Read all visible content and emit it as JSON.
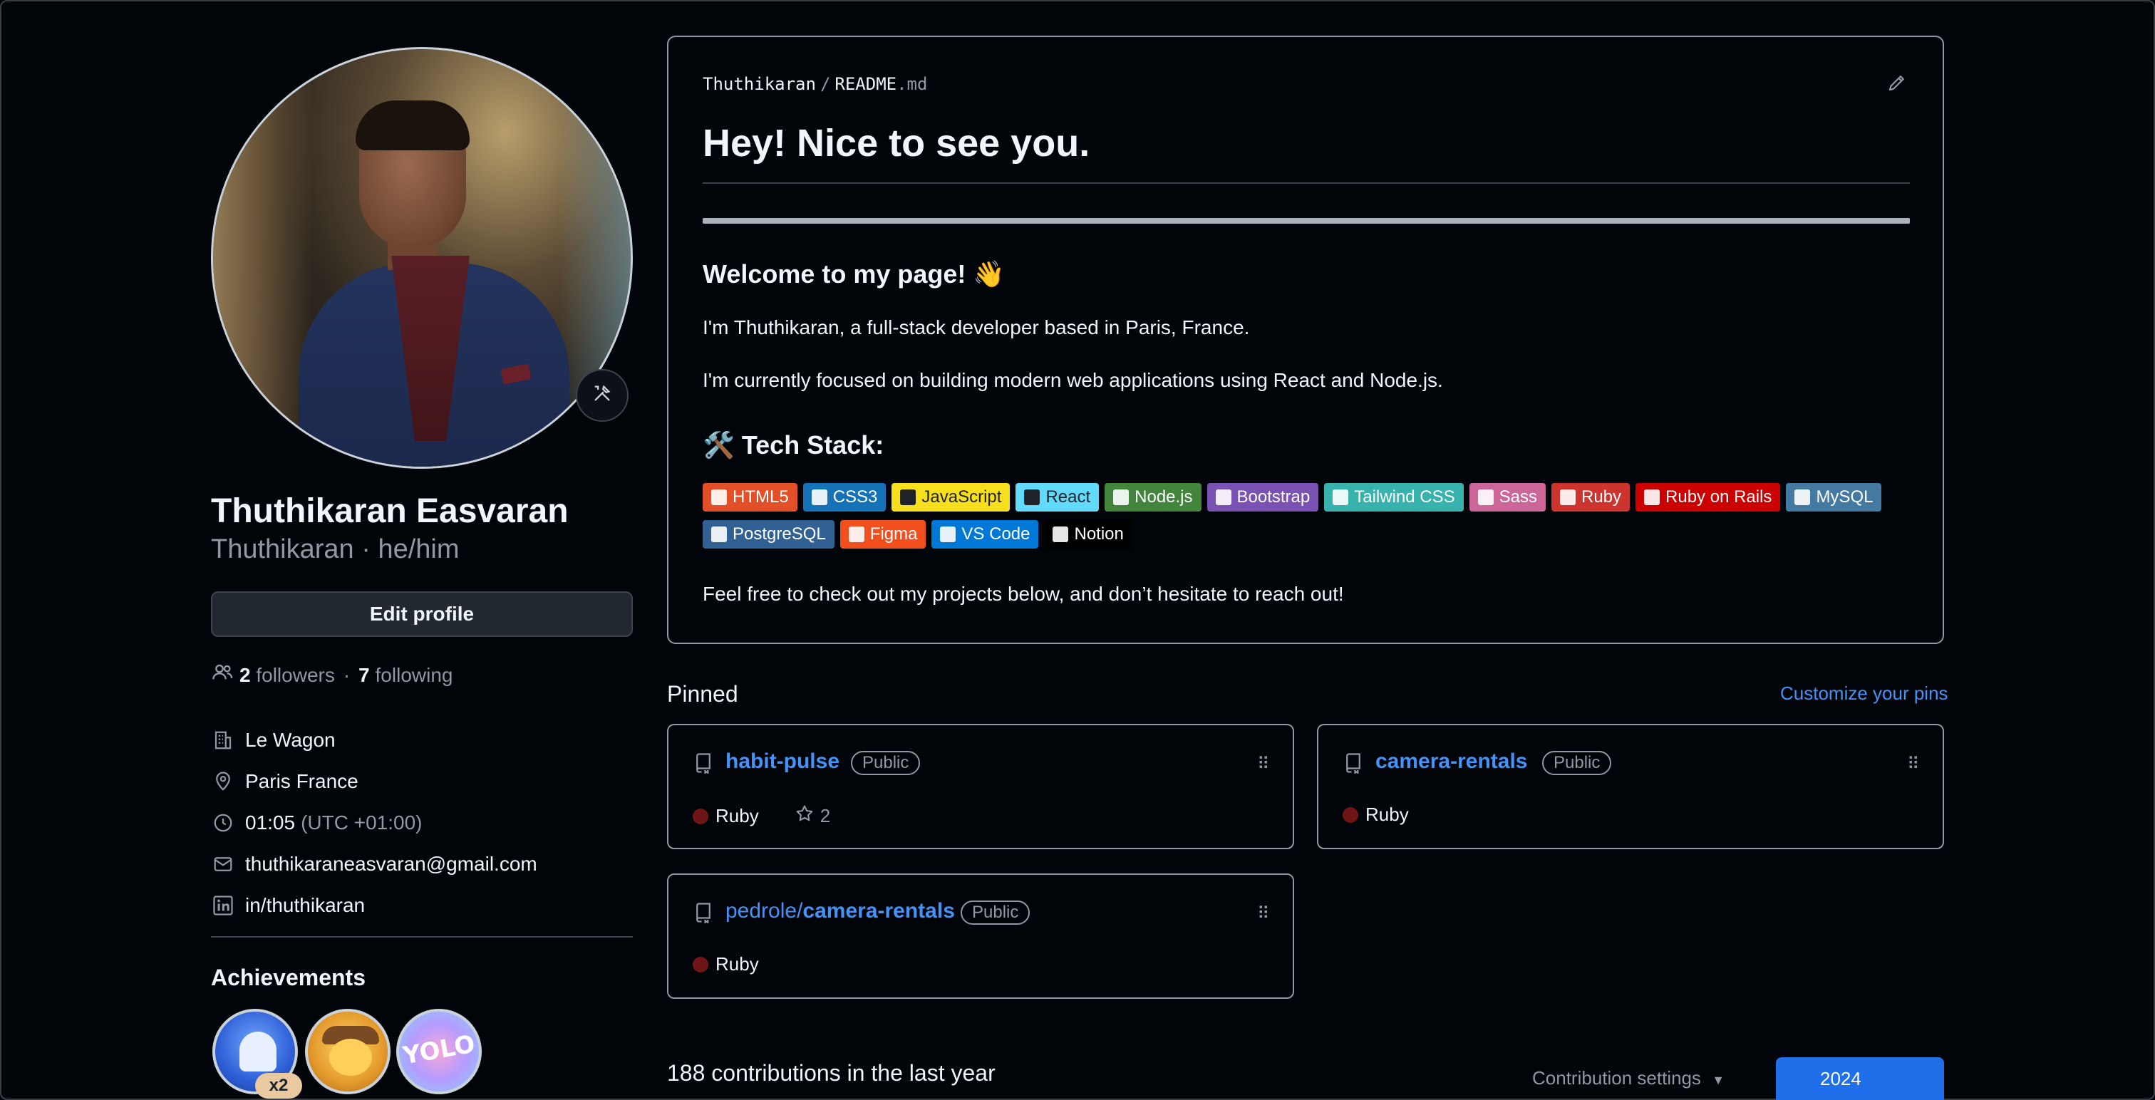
{
  "profile": {
    "name": "Thuthikaran Easvaran",
    "username_line": "Thuthikaran · he/him",
    "edit_label": "Edit profile",
    "followers_count": "2",
    "followers_label": "followers",
    "following_count": "7",
    "following_label": "following",
    "status_icon": "tools-icon"
  },
  "vcard": {
    "organization": "Le Wagon",
    "location": "Paris France",
    "time": "01:05",
    "timezone": "(UTC +01:00)",
    "email": "thuthikaraneasvaran@gmail.com",
    "linkedin": "in/thuthikaran"
  },
  "achievements": {
    "title": "Achievements",
    "badge1_count": "x2",
    "badge3_text": "YOLO"
  },
  "readme": {
    "owner": "Thuthikaran",
    "file": "README",
    "ext": ".md",
    "heading": "Hey! Nice to see you.",
    "welcome": "Welcome to my page! 👋",
    "p1": "I'm Thuthikaran, a full-stack developer based in Paris, France.",
    "p2": "I'm currently focused on building modern web applications using React and Node.js.",
    "tech_heading": "🛠️ Tech Stack:",
    "tech": [
      {
        "label": "HTML5",
        "color": "#e34f26"
      },
      {
        "label": "CSS3",
        "color": "#1572b6"
      },
      {
        "label": "JavaScript",
        "color": "#f7df1e"
      },
      {
        "label": "React",
        "color": "#61dafb"
      },
      {
        "label": "Node.js",
        "color": "#43853d"
      },
      {
        "label": "Bootstrap",
        "color": "#7952b3"
      },
      {
        "label": "Tailwind CSS",
        "color": "#38b2ac"
      },
      {
        "label": "Sass",
        "color": "#cc6699"
      },
      {
        "label": "Ruby",
        "color": "#cc342d"
      },
      {
        "label": "Ruby on Rails",
        "color": "#cc0000"
      },
      {
        "label": "MySQL",
        "color": "#4479a1"
      },
      {
        "label": "PostgreSQL",
        "color": "#316192"
      },
      {
        "label": "Figma",
        "color": "#f24e1e"
      },
      {
        "label": "VS Code",
        "color": "#0078d7"
      },
      {
        "label": "Notion",
        "color": "#000000"
      }
    ],
    "p3": "Feel free to check out my projects below, and don’t hesitate to reach out!"
  },
  "pinned": {
    "title": "Pinned",
    "customize": "Customize your pins",
    "repos": [
      {
        "owner": "",
        "name": "habit-pulse",
        "visibility": "Public",
        "language": "Ruby",
        "stars": "2"
      },
      {
        "owner": "",
        "name": "camera-rentals",
        "visibility": "Public",
        "language": "Ruby",
        "stars": ""
      },
      {
        "owner": "pedrole/",
        "name": "camera-rentals",
        "visibility": "Public",
        "language": "Ruby",
        "stars": ""
      }
    ]
  },
  "contributions": {
    "summary": "188 contributions in the last year",
    "settings": "Contribution settings",
    "year": "2024"
  }
}
